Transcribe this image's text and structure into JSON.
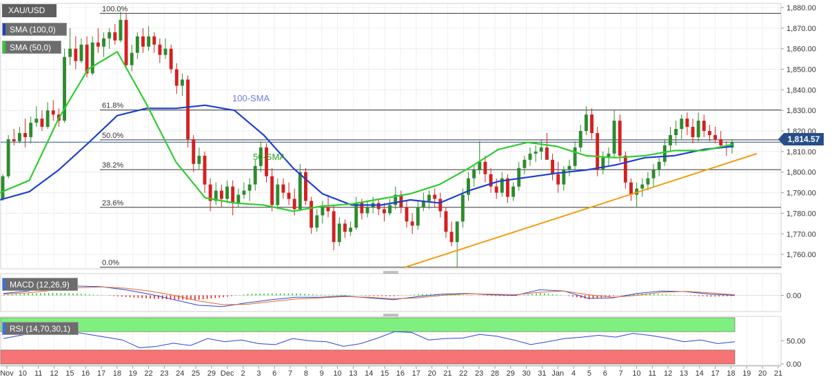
{
  "symbol": "XAU/USD",
  "current_price": "1,814.57",
  "indicators": {
    "sma100": "SMA (100,0)",
    "sma50": "SMA (50,0)",
    "macd": "MACD (12,26,9)",
    "rsi": "RSI (14,70,30,1)"
  },
  "annotations": {
    "sma100_label": "100-SMA",
    "sma50_label": "50-SMA"
  },
  "colors": {
    "sma100": "#1c3fce",
    "sma50": "#2ecc2e",
    "trendline": "#f39c12",
    "candle_up": "#2e8b2e",
    "candle_down": "#d42020",
    "rsi_overbought": "#7ff07f",
    "rsi_oversold": "#f87474",
    "price_tag": "#264f8a"
  },
  "chart_data": [
    {
      "type": "candlestick",
      "title": "XAU/USD",
      "ylim": [
        1753,
        1882
      ],
      "y_ticks": [
        1760,
        1770,
        1780,
        1790,
        1800,
        1810,
        1820,
        1830,
        1840,
        1850,
        1860,
        1870,
        1880
      ],
      "y_tick_labels": [
        "1,760.00",
        "1,770.00",
        "1,780.00",
        "1,790.00",
        "1,800.00",
        "1,810.00",
        "1,820.00",
        "1,830.00",
        "1,840.00",
        "1,850.00",
        "1,860.00",
        "1,870.00",
        "1,880.00"
      ],
      "x_labels": [
        "Nov",
        "10",
        "11",
        "12",
        "15",
        "16",
        "17",
        "18",
        "19",
        "22",
        "23",
        "24",
        "25",
        "29",
        "Dec",
        "2",
        "3",
        "6",
        "7",
        "8",
        "9",
        "10",
        "13",
        "14",
        "15",
        "16",
        "17",
        "20",
        "21",
        "22",
        "23",
        "28",
        "29",
        "30",
        "31",
        "Jan",
        "4",
        "5",
        "6",
        "7",
        "10",
        "11",
        "12",
        "13",
        "14",
        "17",
        "18",
        "19",
        "20",
        "21"
      ],
      "fibonacci": [
        {
          "label": "100.0%",
          "value": 1877.2
        },
        {
          "label": "61.8%",
          "value": 1830.2
        },
        {
          "label": "50.0%",
          "value": 1815.7
        },
        {
          "label": "38.2%",
          "value": 1801.2
        },
        {
          "label": "23.6%",
          "value": 1782.9
        },
        {
          "label": "0.0%",
          "value": 1753.8
        }
      ],
      "current_price": 1814.57,
      "trendline": {
        "start": [
          15,
          1753.8
        ],
        "end": [
          20,
          1809.0
        ]
      },
      "series": [
        {
          "name": "100-SMA",
          "values": [
            1786.5,
            1790.5,
            1801.0,
            1814.0,
            1827.5,
            1831.0,
            1831.0,
            1832.5,
            1830.0,
            1818.0,
            1802.0,
            1789.5,
            1784.0,
            1784.0,
            1786.5,
            1785.0,
            1791.0,
            1795.5,
            1797.5,
            1799.5,
            1801.0,
            1803.5,
            1807.0,
            1808.0,
            1811.0,
            1812.5
          ]
        },
        {
          "name": "50-SMA",
          "values": [
            1790.0,
            1796.0,
            1826.0,
            1850.0,
            1858.5,
            1833.0,
            1805.0,
            1787.5,
            1785.0,
            1784.0,
            1781.0,
            1783.5,
            1784.5,
            1787.0,
            1789.5,
            1794.0,
            1802.0,
            1811.0,
            1814.5,
            1812.5,
            1808.0,
            1807.0,
            1808.0,
            1810.5,
            1810.5,
            1813.5
          ]
        }
      ],
      "candles": [
        [
          1787.0,
          1799.0,
          1786.0,
          1798.0
        ],
        [
          1798.0,
          1818.0,
          1797.0,
          1816.0
        ],
        [
          1816.0,
          1821.0,
          1813.0,
          1815.0
        ],
        [
          1815.0,
          1822.0,
          1814.0,
          1819.0
        ],
        [
          1819.0,
          1826.0,
          1812.0,
          1817.0
        ],
        [
          1817.0,
          1827.0,
          1814.0,
          1824.0
        ],
        [
          1824.0,
          1832.0,
          1822.0,
          1826.0
        ],
        [
          1826.0,
          1830.0,
          1820.0,
          1822.0
        ],
        [
          1822.0,
          1834.0,
          1821.0,
          1830.0
        ],
        [
          1830.0,
          1835.0,
          1825.0,
          1828.0
        ],
        [
          1828.0,
          1831.0,
          1822.0,
          1825.0
        ],
        [
          1825.0,
          1860.0,
          1824.0,
          1856.0
        ],
        [
          1856.0,
          1870.0,
          1852.0,
          1860.0
        ],
        [
          1860.0,
          1866.0,
          1850.0,
          1854.0
        ],
        [
          1854.0,
          1865.0,
          1853.0,
          1862.0
        ],
        [
          1862.0,
          1866.0,
          1846.0,
          1848.0
        ],
        [
          1848.0,
          1866.0,
          1847.0,
          1863.0
        ],
        [
          1863.0,
          1870.0,
          1858.0,
          1861.0
        ],
        [
          1861.0,
          1868.0,
          1856.0,
          1865.0
        ],
        [
          1865.0,
          1870.0,
          1860.0,
          1868.0
        ],
        [
          1868.0,
          1872.0,
          1862.0,
          1864.0
        ],
        [
          1864.0,
          1878.0,
          1863.0,
          1874.0
        ],
        [
          1874.0,
          1877.0,
          1850.0,
          1852.0
        ],
        [
          1852.0,
          1862.0,
          1849.0,
          1858.0
        ],
        [
          1858.0,
          1868.0,
          1855.0,
          1866.0
        ],
        [
          1866.0,
          1870.0,
          1858.0,
          1861.0
        ],
        [
          1861.0,
          1871.0,
          1859.0,
          1866.0
        ],
        [
          1866.0,
          1868.0,
          1858.0,
          1862.0
        ],
        [
          1862.0,
          1865.0,
          1853.0,
          1857.0
        ],
        [
          1857.0,
          1865.0,
          1855.0,
          1860.0
        ],
        [
          1860.0,
          1862.0,
          1848.0,
          1850.0
        ],
        [
          1850.0,
          1853.0,
          1838.0,
          1842.0
        ],
        [
          1842.0,
          1848.0,
          1837.0,
          1845.0
        ],
        [
          1845.0,
          1847.0,
          1812.0,
          1816.0
        ],
        [
          1816.0,
          1818.0,
          1800.0,
          1804.0
        ],
        [
          1804.0,
          1812.0,
          1801.0,
          1808.0
        ],
        [
          1808.0,
          1810.0,
          1790.0,
          1794.0
        ],
        [
          1794.0,
          1797.0,
          1781.0,
          1786.0
        ],
        [
          1786.0,
          1795.0,
          1784.0,
          1791.0
        ],
        [
          1791.0,
          1794.0,
          1783.0,
          1787.0
        ],
        [
          1787.0,
          1796.0,
          1785.0,
          1793.0
        ],
        [
          1793.0,
          1796.0,
          1779.0,
          1785.0
        ],
        [
          1785.0,
          1792.0,
          1783.0,
          1789.0
        ],
        [
          1789.0,
          1795.0,
          1787.0,
          1791.0
        ],
        [
          1791.0,
          1797.0,
          1786.0,
          1794.0
        ],
        [
          1794.0,
          1806.0,
          1791.0,
          1803.0
        ],
        [
          1803.0,
          1815.0,
          1800.0,
          1812.0
        ],
        [
          1812.0,
          1814.0,
          1795.0,
          1798.0
        ],
        [
          1798.0,
          1802.0,
          1781.0,
          1784.0
        ],
        [
          1784.0,
          1797.0,
          1782.0,
          1794.0
        ],
        [
          1794.0,
          1797.0,
          1787.0,
          1790.0
        ],
        [
          1790.0,
          1795.0,
          1784.0,
          1787.0
        ],
        [
          1787.0,
          1792.0,
          1779.0,
          1782.0
        ],
        [
          1782.0,
          1804.0,
          1781.0,
          1800.0
        ],
        [
          1800.0,
          1802.0,
          1784.0,
          1786.0
        ],
        [
          1786.0,
          1788.0,
          1770.0,
          1773.0
        ],
        [
          1773.0,
          1782.0,
          1771.0,
          1779.0
        ],
        [
          1779.0,
          1786.0,
          1775.0,
          1783.0
        ],
        [
          1783.0,
          1789.0,
          1778.0,
          1781.0
        ],
        [
          1781.0,
          1784.0,
          1762.0,
          1766.0
        ],
        [
          1766.0,
          1778.0,
          1764.0,
          1775.0
        ],
        [
          1775.0,
          1777.0,
          1768.0,
          1771.0
        ],
        [
          1771.0,
          1776.0,
          1769.0,
          1773.0
        ],
        [
          1773.0,
          1788.0,
          1772.0,
          1785.0
        ],
        [
          1785.0,
          1787.0,
          1777.0,
          1780.0
        ],
        [
          1780.0,
          1786.0,
          1778.0,
          1783.0
        ],
        [
          1783.0,
          1788.0,
          1780.0,
          1785.0
        ],
        [
          1785.0,
          1787.0,
          1779.0,
          1782.0
        ],
        [
          1782.0,
          1785.0,
          1776.0,
          1780.0
        ],
        [
          1780.0,
          1787.0,
          1779.0,
          1784.0
        ],
        [
          1784.0,
          1793.0,
          1782.0,
          1789.0
        ],
        [
          1789.0,
          1791.0,
          1780.0,
          1783.0
        ],
        [
          1783.0,
          1786.0,
          1773.0,
          1776.0
        ],
        [
          1776.0,
          1780.0,
          1770.0,
          1774.0
        ],
        [
          1774.0,
          1786.0,
          1772.0,
          1783.0
        ],
        [
          1783.0,
          1790.0,
          1781.0,
          1786.0
        ],
        [
          1786.0,
          1791.0,
          1782.0,
          1789.0
        ],
        [
          1789.0,
          1792.0,
          1783.0,
          1787.0
        ],
        [
          1787.0,
          1790.0,
          1778.0,
          1781.0
        ],
        [
          1781.0,
          1783.0,
          1768.0,
          1771.0
        ],
        [
          1771.0,
          1776.0,
          1764.0,
          1766.0
        ],
        [
          1766.0,
          1768.0,
          1754.0,
          1776.0
        ],
        [
          1776.0,
          1792.0,
          1773.0,
          1789.0
        ],
        [
          1789.0,
          1800.0,
          1786.0,
          1797.0
        ],
        [
          1797.0,
          1803.0,
          1793.0,
          1801.0
        ],
        [
          1801.0,
          1815.0,
          1799.0,
          1805.0
        ],
        [
          1805.0,
          1808.0,
          1795.0,
          1799.0
        ],
        [
          1799.0,
          1802.0,
          1790.0,
          1793.0
        ],
        [
          1793.0,
          1797.0,
          1787.0,
          1790.0
        ],
        [
          1790.0,
          1800.0,
          1788.0,
          1797.0
        ],
        [
          1797.0,
          1799.0,
          1785.0,
          1788.0
        ],
        [
          1788.0,
          1795.0,
          1786.0,
          1793.0
        ],
        [
          1793.0,
          1805.0,
          1791.0,
          1802.0
        ],
        [
          1802.0,
          1808.0,
          1799.0,
          1806.0
        ],
        [
          1806.0,
          1812.0,
          1803.0,
          1809.0
        ],
        [
          1809.0,
          1813.0,
          1805.0,
          1810.0
        ],
        [
          1810.0,
          1816.0,
          1806.0,
          1812.0
        ],
        [
          1812.0,
          1819.0,
          1808.0,
          1806.0
        ],
        [
          1806.0,
          1809.0,
          1796.0,
          1799.0
        ],
        [
          1799.0,
          1805.0,
          1790.0,
          1794.0
        ],
        [
          1794.0,
          1803.0,
          1791.0,
          1801.0
        ],
        [
          1801.0,
          1806.0,
          1798.0,
          1803.0
        ],
        [
          1803.0,
          1815.0,
          1801.0,
          1812.0
        ],
        [
          1812.0,
          1823.0,
          1810.0,
          1820.0
        ],
        [
          1820.0,
          1832.0,
          1818.0,
          1828.0
        ],
        [
          1828.0,
          1831.0,
          1816.0,
          1819.0
        ],
        [
          1819.0,
          1822.0,
          1798.0,
          1801.0
        ],
        [
          1801.0,
          1810.0,
          1799.0,
          1807.0
        ],
        [
          1807.0,
          1812.0,
          1803.0,
          1809.0
        ],
        [
          1809.0,
          1830.0,
          1807.0,
          1825.0
        ],
        [
          1825.0,
          1828.0,
          1805.0,
          1808.0
        ],
        [
          1808.0,
          1810.0,
          1792.0,
          1795.0
        ],
        [
          1795.0,
          1797.0,
          1786.0,
          1789.0
        ],
        [
          1789.0,
          1795.0,
          1783.0,
          1792.0
        ],
        [
          1792.0,
          1797.0,
          1788.0,
          1794.0
        ],
        [
          1794.0,
          1800.0,
          1791.0,
          1797.0
        ],
        [
          1797.0,
          1804.0,
          1793.0,
          1801.0
        ],
        [
          1801.0,
          1807.0,
          1798.0,
          1805.0
        ],
        [
          1805.0,
          1816.0,
          1803.0,
          1813.0
        ],
        [
          1813.0,
          1822.0,
          1810.0,
          1818.0
        ],
        [
          1818.0,
          1825.0,
          1813.0,
          1821.0
        ],
        [
          1821.0,
          1828.0,
          1816.0,
          1826.0
        ],
        [
          1826.0,
          1829.0,
          1818.0,
          1822.0
        ],
        [
          1822.0,
          1826.0,
          1814.0,
          1817.0
        ],
        [
          1817.0,
          1829.0,
          1815.0,
          1825.0
        ],
        [
          1825.0,
          1828.0,
          1817.0,
          1820.0
        ],
        [
          1820.0,
          1823.0,
          1815.0,
          1818.0
        ],
        [
          1818.0,
          1822.0,
          1814.0,
          1816.0
        ],
        [
          1816.0,
          1820.0,
          1812.0,
          1813.0
        ],
        [
          1813.0,
          1815.0,
          1808.0,
          1812.0
        ],
        [
          1812.0,
          1816.0,
          1809.0,
          1814.57
        ]
      ]
    },
    {
      "type": "line",
      "title": "MACD (12,26,9)",
      "y_ticks": [
        0
      ],
      "y_tick_labels": [
        "0.00"
      ],
      "ylim": [
        -1,
        1
      ],
      "series": [
        {
          "name": "MACD",
          "values": [
            0.15,
            0.35,
            0.6,
            0.75,
            0.7,
            0.45,
            0.1,
            -0.35,
            -0.8,
            -0.9,
            -0.6,
            -0.35,
            -0.15,
            -0.15,
            -0.05,
            -0.2,
            -0.35,
            -0.1,
            0.1,
            0.15,
            0.05,
            0.0,
            0.45,
            0.35,
            -0.25,
            -0.2,
            0.15,
            0.35,
            0.3,
            0.1,
            0.0
          ]
        },
        {
          "name": "Signal",
          "values": [
            0.1,
            0.2,
            0.4,
            0.6,
            0.68,
            0.58,
            0.35,
            0.0,
            -0.45,
            -0.75,
            -0.72,
            -0.5,
            -0.3,
            -0.2,
            -0.1,
            -0.15,
            -0.28,
            -0.2,
            0.0,
            0.12,
            0.1,
            0.05,
            0.25,
            0.35,
            0.05,
            -0.15,
            0.0,
            0.25,
            0.32,
            0.2,
            0.05
          ]
        }
      ],
      "histogram": [
        0.05,
        0.15,
        0.2,
        0.15,
        0.02,
        -0.13,
        -0.25,
        -0.35,
        -0.35,
        -0.15,
        0.12,
        0.15,
        0.15,
        0.05,
        0.05,
        -0.05,
        -0.07,
        0.1,
        0.1,
        0.03,
        -0.05,
        -0.05,
        0.2,
        0.0,
        -0.3,
        -0.05,
        0.15,
        0.1,
        -0.02,
        -0.1,
        -0.05
      ]
    },
    {
      "type": "line",
      "title": "RSI (14,70,30,1)",
      "y_ticks": [
        0,
        50
      ],
      "y_tick_labels": [
        "0.00",
        "50.00"
      ],
      "ylim": [
        0,
        100
      ],
      "bands": [
        {
          "from": 70,
          "to": 100,
          "label": "overbought"
        },
        {
          "from": 0,
          "to": 30,
          "label": "oversold"
        }
      ],
      "series": [
        {
          "name": "RSI",
          "values": [
            55,
            62,
            68,
            72,
            70,
            64,
            58,
            52,
            35,
            38,
            45,
            40,
            55,
            48,
            52,
            44,
            42,
            55,
            50,
            48,
            38,
            44,
            56,
            70,
            68,
            52,
            55,
            56,
            64,
            60,
            52,
            42,
            48,
            55,
            58,
            62,
            58,
            66,
            62,
            56,
            48,
            52,
            44,
            48
          ]
        }
      ]
    }
  ]
}
